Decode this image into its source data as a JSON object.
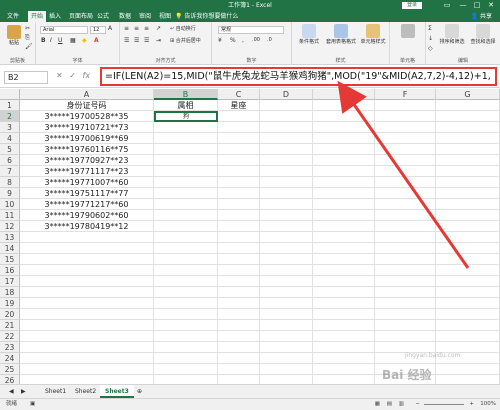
{
  "window": {
    "title": "工作簿1 - Excel",
    "login": "登录",
    "min": "—",
    "max": "□",
    "close": "✕"
  },
  "tabs": [
    "文件",
    "开始",
    "插入",
    "页面布局",
    "公式",
    "数据",
    "审阅",
    "视图",
    "帮助"
  ],
  "active_tab_index": 1,
  "tell_me": "告诉我你想要做什么",
  "share": "共享",
  "ribbon": {
    "paste": "粘贴",
    "clipboard": "剪贴板",
    "font_name": "Arial",
    "font_size": "12",
    "font_group": "字体",
    "align_group": "对齐方式",
    "number_group": "数字",
    "number_format": "常规",
    "cond_format": "条件格式",
    "table_format": "套用表格格式",
    "cell_styles": "单元格样式",
    "styles_group": "样式",
    "cells": "单元格",
    "sort_filter": "排序和筛选",
    "find_select": "查找和选择",
    "edit_group": "编辑",
    "wrap": "自动换行",
    "merge": "合并后居中"
  },
  "formula_bar": {
    "name_box": "B2",
    "fx": "fx",
    "formula": "=IF(LEN(A2)=15,MID(\"鼠牛虎兔龙蛇马羊猴鸡狗猪\",MOD(\"19\"&MID(A2,7,2)-4,12)+1,"
  },
  "columns": [
    "A",
    "B",
    "C",
    "D",
    "E",
    "F",
    "G"
  ],
  "selected_column": "B",
  "rows": [
    {
      "num": "1",
      "a": "身份证号码",
      "b": "属相",
      "c": "星座"
    },
    {
      "num": "2",
      "a": "3*****19700528**35",
      "b": "狗",
      "c": ""
    },
    {
      "num": "3",
      "a": "3*****19710721**73",
      "b": "",
      "c": ""
    },
    {
      "num": "4",
      "a": "3*****19700619**69",
      "b": "",
      "c": ""
    },
    {
      "num": "5",
      "a": "3*****19760116**75",
      "b": "",
      "c": ""
    },
    {
      "num": "6",
      "a": "3*****19770927**23",
      "b": "",
      "c": ""
    },
    {
      "num": "7",
      "a": "3*****19771117**23",
      "b": "",
      "c": ""
    },
    {
      "num": "8",
      "a": "3*****19771007**60",
      "b": "",
      "c": ""
    },
    {
      "num": "9",
      "a": "3*****19751117**77",
      "b": "",
      "c": ""
    },
    {
      "num": "10",
      "a": "3*****19771217**60",
      "b": "",
      "c": ""
    },
    {
      "num": "11",
      "a": "3*****19790602**60",
      "b": "",
      "c": ""
    },
    {
      "num": "12",
      "a": "3*****19780419**12",
      "b": "",
      "c": ""
    },
    {
      "num": "13",
      "a": "",
      "b": "",
      "c": ""
    },
    {
      "num": "14",
      "a": "",
      "b": "",
      "c": ""
    },
    {
      "num": "15",
      "a": "",
      "b": "",
      "c": ""
    },
    {
      "num": "16",
      "a": "",
      "b": "",
      "c": ""
    },
    {
      "num": "17",
      "a": "",
      "b": "",
      "c": ""
    },
    {
      "num": "18",
      "a": "",
      "b": "",
      "c": ""
    },
    {
      "num": "19",
      "a": "",
      "b": "",
      "c": ""
    },
    {
      "num": "20",
      "a": "",
      "b": "",
      "c": ""
    },
    {
      "num": "21",
      "a": "",
      "b": "",
      "c": ""
    },
    {
      "num": "22",
      "a": "",
      "b": "",
      "c": ""
    },
    {
      "num": "23",
      "a": "",
      "b": "",
      "c": ""
    },
    {
      "num": "24",
      "a": "",
      "b": "",
      "c": ""
    },
    {
      "num": "25",
      "a": "",
      "b": "",
      "c": ""
    },
    {
      "num": "26",
      "a": "",
      "b": "",
      "c": ""
    }
  ],
  "active_cell": "B2",
  "sheets": [
    "Sheet1",
    "Sheet2",
    "Sheet3"
  ],
  "active_sheet_index": 2,
  "status": {
    "left": "就绪",
    "zoom": "100%"
  },
  "watermark": "Bai 经验",
  "watermark_url": "jingyan.baidu.com",
  "colors": {
    "excel_green": "#217346",
    "highlight_red": "#e53935"
  }
}
